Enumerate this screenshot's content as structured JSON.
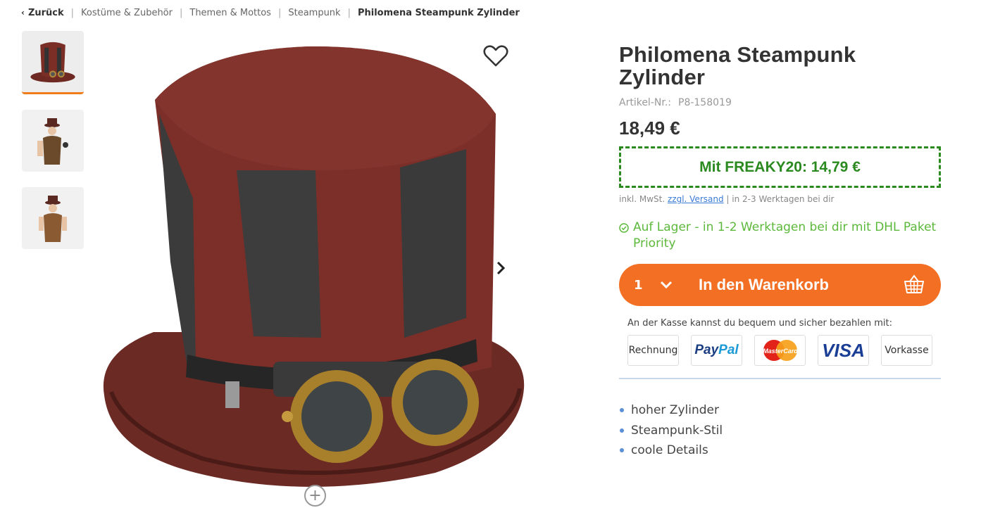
{
  "breadcrumb": {
    "back": "Zurück",
    "items": [
      "Kostüme & Zubehör",
      "Themen & Mottos",
      "Steampunk"
    ],
    "current": "Philomena Steampunk Zylinder",
    "separator": "|"
  },
  "product": {
    "title": "Philomena Steampunk Zylinder",
    "article_label": "Artikel-Nr.:",
    "article_number": "P8-158019",
    "price": "18,49 €",
    "coupon": "Mit FREAKY20: 14,79 €",
    "tax_prefix": "inkl. MwSt.",
    "shipping_link": "zzgl. Versand",
    "tax_suffix": "| in 2-3 Werktagen bei dir",
    "stock": "Auf Lager - in 1-2 Werktagen bei dir mit DHL Paket Priority",
    "quantity": "1",
    "cart_label": "In den Warenkorb",
    "payment_note": "An der Kasse kannst du bequem und sicher bezahlen mit:",
    "payment": {
      "rechnung": "Rechnung",
      "paypal_1": "Pay",
      "paypal_2": "Pal",
      "mastercard": "MasterCard",
      "visa": "VISA",
      "vorkasse": "Vorkasse"
    },
    "features": [
      "hoher Zylinder",
      "Steampunk-Stil",
      "coole Details"
    ]
  },
  "colors": {
    "accent_orange": "#f26f24",
    "coupon_green": "#2b8a1f",
    "stock_green": "#5cb83b",
    "link_blue": "#3a7bd5"
  },
  "icons": [
    "chevron-left-icon",
    "heart-icon",
    "chevron-right-icon",
    "zoom-plus-icon",
    "check-circle-icon",
    "chevron-down-icon",
    "basket-icon"
  ]
}
